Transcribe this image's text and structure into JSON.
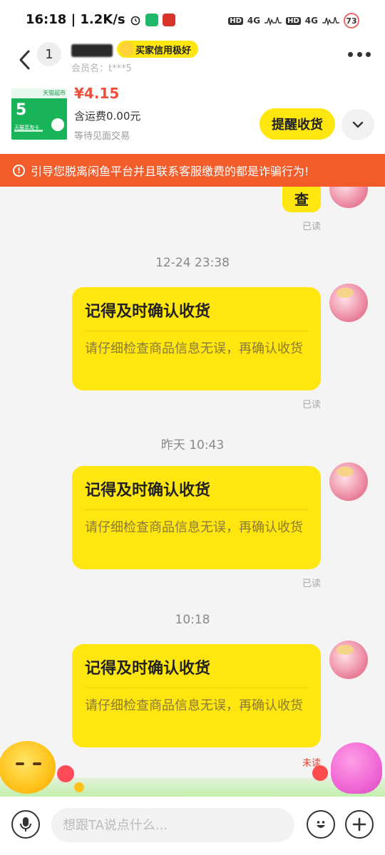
{
  "status_bar": {
    "time_speed": "16:18 | 1.2K/s",
    "network1": "4G",
    "network2": "4G",
    "hd1": "HD",
    "hd2": "HD",
    "battery": "73"
  },
  "header": {
    "unread_count": "1",
    "credit_badge": "买家信用极好",
    "member_name": "会员名：t***5"
  },
  "product": {
    "image_label_top": "天猫超市",
    "image_number": "5",
    "image_caption": "天猫享淘卡",
    "price": "¥4.15",
    "shipping": "含运费0.00元",
    "status": "等待见面交易",
    "remind_button": "提醒收货"
  },
  "warning": {
    "text": "引导您脱离闲鱼平台并且联系客服缴费的都是诈骗行为!"
  },
  "chat": {
    "prev_bubble_text": "查",
    "prev_read": "已读",
    "messages": [
      {
        "timestamp": "12-24 23:38",
        "title": "记得及时确认收货",
        "body": "请仔细检查商品信息无误，再确认收货",
        "read_status": "已读"
      },
      {
        "timestamp": "昨天 10:43",
        "title": "记得及时确认收货",
        "body": "请仔细检查商品信息无误，再确认收货",
        "read_status": "已读"
      },
      {
        "timestamp": "10:18",
        "title": "记得及时确认收货",
        "body": "请仔细检查商品信息无误，再确认收货",
        "read_status": "未读"
      }
    ]
  },
  "input": {
    "placeholder": "想跟TA说点什么..."
  },
  "colors": {
    "brand_yellow": "#ffe60f",
    "price_red": "#ef4e3a",
    "warning_orange": "#f25b2a",
    "unread_red": "#e64533"
  }
}
